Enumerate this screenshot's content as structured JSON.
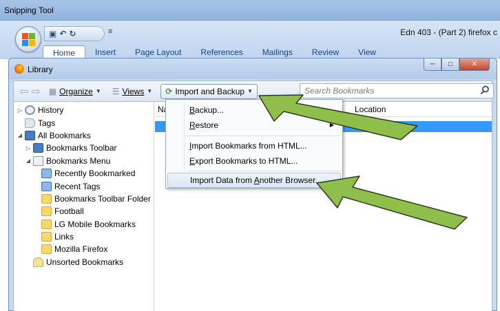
{
  "snipping": {
    "title": "Snipping Tool"
  },
  "word": {
    "doc_title": "Edn 403 - (Part 2) firefox c",
    "qat_more": "≡",
    "tabs": [
      {
        "label": "Home"
      },
      {
        "label": "Insert"
      },
      {
        "label": "Page Layout"
      },
      {
        "label": "References"
      },
      {
        "label": "Mailings"
      },
      {
        "label": "Review"
      },
      {
        "label": "View"
      }
    ]
  },
  "library": {
    "title": "Library",
    "toolbar": {
      "organize": "Organize",
      "views": "Views",
      "import_backup": "Import and Backup",
      "search_placeholder": "Search Bookmarks"
    },
    "tree": [
      {
        "label": "History"
      },
      {
        "label": "Tags"
      },
      {
        "label": "All Bookmarks"
      },
      {
        "label": "Bookmarks Toolbar"
      },
      {
        "label": "Bookmarks Menu"
      },
      {
        "label": "Recently Bookmarked"
      },
      {
        "label": "Recent Tags"
      },
      {
        "label": "Bookmarks Toolbar Folder"
      },
      {
        "label": "Football"
      },
      {
        "label": "LG Mobile Bookmarks"
      },
      {
        "label": "Links"
      },
      {
        "label": "Mozilla Firefox"
      },
      {
        "label": "Unsorted Bookmarks"
      }
    ],
    "columns": {
      "name": "Na",
      "location": "Location"
    }
  },
  "menu": {
    "items": [
      {
        "pre": "",
        "u": "B",
        "post": "ackup..."
      },
      {
        "pre": "",
        "u": "R",
        "post": "estore"
      },
      {
        "pre": "",
        "u": "I",
        "post": "mport Bookmarks from HTML..."
      },
      {
        "pre": "",
        "u": "E",
        "post": "xport Bookmarks to HTML..."
      },
      {
        "pre": "Import Data from ",
        "u": "A",
        "post": "nother Browser..."
      }
    ]
  },
  "colors": {
    "selection": "#3399ff",
    "arrow": "#8fbf4a",
    "arrow_stroke": "#2d3a1a",
    "ribbon_text": "#15428b"
  },
  "icons": [
    "office-button-icon",
    "save-icon",
    "undo-icon",
    "redo-icon",
    "firefox-icon",
    "search-icon",
    "folder-icon",
    "star-icon",
    "clock-icon",
    "tag-icon",
    "import-backup-icon",
    "submenu-arrow-icon"
  ]
}
